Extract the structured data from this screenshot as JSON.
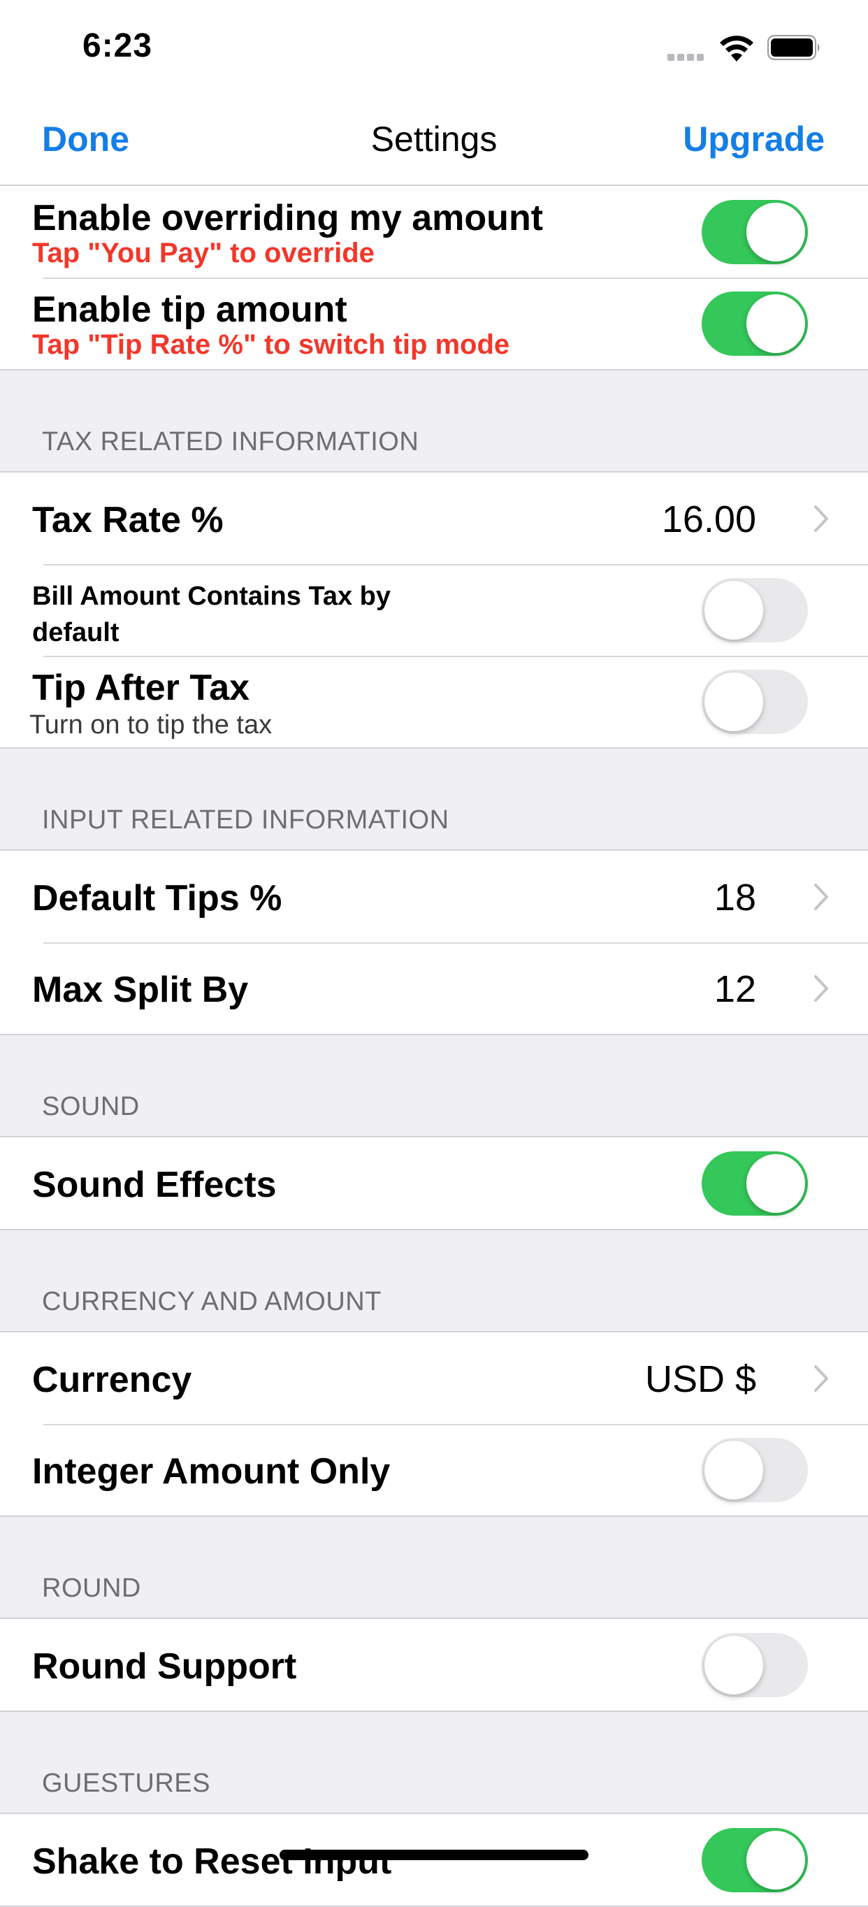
{
  "status": {
    "time": "6:23"
  },
  "nav": {
    "done": "Done",
    "title": "Settings",
    "upgrade": "Upgrade"
  },
  "general": [
    {
      "label": "Enable overriding my amount",
      "sub": "Tap \"You Pay\" to override",
      "on": true
    },
    {
      "label": "Enable tip amount",
      "sub": "Tap \"Tip Rate %\" to switch tip mode",
      "on": true
    }
  ],
  "tax": {
    "header": "TAX RELATED INFORMATION",
    "tax_rate": {
      "label": "Tax Rate %",
      "value": "16.00"
    },
    "bill_contains_tax": {
      "label": "Bill Amount Contains Tax by default",
      "on": false
    },
    "tip_after_tax": {
      "label": "Tip After Tax",
      "sub": "Turn on to tip the tax",
      "on": false
    }
  },
  "input": {
    "header": "INPUT RELATED INFORMATION",
    "default_tips": {
      "label": "Default Tips %",
      "value": "18"
    },
    "max_split": {
      "label": "Max Split By",
      "value": "12"
    }
  },
  "sound": {
    "header": "SOUND",
    "effects": {
      "label": "Sound Effects",
      "on": true
    }
  },
  "currency": {
    "header": "CURRENCY AND AMOUNT",
    "currency": {
      "label": "Currency",
      "value": "USD $"
    },
    "integer_only": {
      "label": "Integer Amount Only",
      "on": false
    }
  },
  "round": {
    "header": "ROUND",
    "support": {
      "label": "Round Support",
      "on": false
    }
  },
  "gestures": {
    "header": "GUESTURES",
    "shake": {
      "label": "Shake to Reset Input",
      "on": true
    }
  },
  "colors": {
    "accent": "#147ee6",
    "toggle_on": "#34c759",
    "warning": "#f2372a"
  }
}
